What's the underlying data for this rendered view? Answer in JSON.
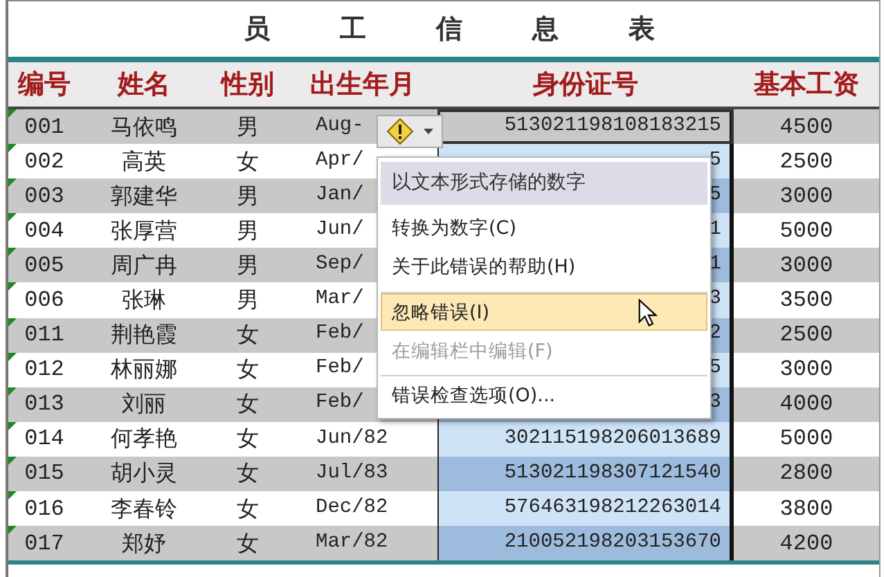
{
  "title": "员 工 信 息 表",
  "columns": [
    "编号",
    "姓名",
    "性别",
    "出生年月",
    "身份证号",
    "基本工资"
  ],
  "rows": [
    {
      "code": "001",
      "name": "马依鸣",
      "gender": "男",
      "birth": "Aug-",
      "id_card": {
        "text": "513021198108183215",
        "selected": false,
        "active": true
      },
      "salary": "4500",
      "shaded": true,
      "flagged": true
    },
    {
      "code": "002",
      "name": "高英",
      "gender": "女",
      "birth": "Apr/",
      "id_card": {
        "text": "5",
        "selected": true,
        "active": false
      },
      "salary": "2500",
      "shaded": false,
      "flagged": true
    },
    {
      "code": "003",
      "name": "郭建华",
      "gender": "男",
      "birth": "Jan/",
      "id_card": {
        "text": "5",
        "selected": true,
        "active": false
      },
      "salary": "3000",
      "shaded": true,
      "flagged": true
    },
    {
      "code": "004",
      "name": "张厚营",
      "gender": "男",
      "birth": "Jun/",
      "id_card": {
        "text": "1",
        "selected": true,
        "active": false
      },
      "salary": "5000",
      "shaded": false,
      "flagged": true
    },
    {
      "code": "005",
      "name": "周广冉",
      "gender": "男",
      "birth": "Sep/",
      "id_card": {
        "text": "1",
        "selected": true,
        "active": false
      },
      "salary": "3000",
      "shaded": true,
      "flagged": true
    },
    {
      "code": "006",
      "name": "张琳",
      "gender": "男",
      "birth": "Mar/",
      "id_card": {
        "text": "3",
        "selected": true,
        "active": false
      },
      "salary": "3500",
      "shaded": false,
      "flagged": true
    },
    {
      "code": "011",
      "name": "荆艳霞",
      "gender": "女",
      "birth": "Feb/",
      "id_card": {
        "text": "2",
        "selected": true,
        "active": false
      },
      "salary": "2500",
      "shaded": true,
      "flagged": true
    },
    {
      "code": "012",
      "name": "林丽娜",
      "gender": "女",
      "birth": "Feb/",
      "id_card": {
        "text": "5",
        "selected": true,
        "active": false
      },
      "salary": "3000",
      "shaded": false,
      "flagged": true
    },
    {
      "code": "013",
      "name": "刘丽",
      "gender": "女",
      "birth": "Feb/",
      "id_card": {
        "text": "3",
        "selected": true,
        "active": false
      },
      "salary": "4000",
      "shaded": true,
      "flagged": true
    },
    {
      "code": "014",
      "name": "何孝艳",
      "gender": "女",
      "birth": "Jun/82",
      "id_card": {
        "text": "302115198206013689",
        "selected": true,
        "active": false
      },
      "salary": "5000",
      "shaded": false,
      "flagged": true
    },
    {
      "code": "015",
      "name": "胡小灵",
      "gender": "女",
      "birth": "Jul/83",
      "id_card": {
        "text": "513021198307121540",
        "selected": true,
        "active": false
      },
      "salary": "2800",
      "shaded": true,
      "flagged": true
    },
    {
      "code": "016",
      "name": "李春铃",
      "gender": "女",
      "birth": "Dec/82",
      "id_card": {
        "text": "576463198212263014",
        "selected": true,
        "active": false
      },
      "salary": "3800",
      "shaded": false,
      "flagged": true
    },
    {
      "code": "017",
      "name": "郑妤",
      "gender": "女",
      "birth": "Mar/82",
      "id_card": {
        "text": "210052198203153670",
        "selected": true,
        "active": false
      },
      "salary": "4200",
      "shaded": true,
      "flagged": true
    }
  ],
  "error_menu": {
    "header": "以文本形式存储的数字",
    "items": [
      {
        "label": "转换为数字(C)",
        "selected": false,
        "disabled": false,
        "separator_before": false
      },
      {
        "label": "关于此错误的帮助(H)",
        "selected": false,
        "disabled": false,
        "separator_before": false
      },
      {
        "label": "忽略错误(I)",
        "selected": true,
        "disabled": false,
        "separator_before": true
      },
      {
        "label": "在编辑栏中编辑(F)",
        "selected": false,
        "disabled": true,
        "separator_before": false
      },
      {
        "label": "错误检查选项(O)...",
        "selected": false,
        "disabled": false,
        "separator_before": true
      }
    ]
  }
}
